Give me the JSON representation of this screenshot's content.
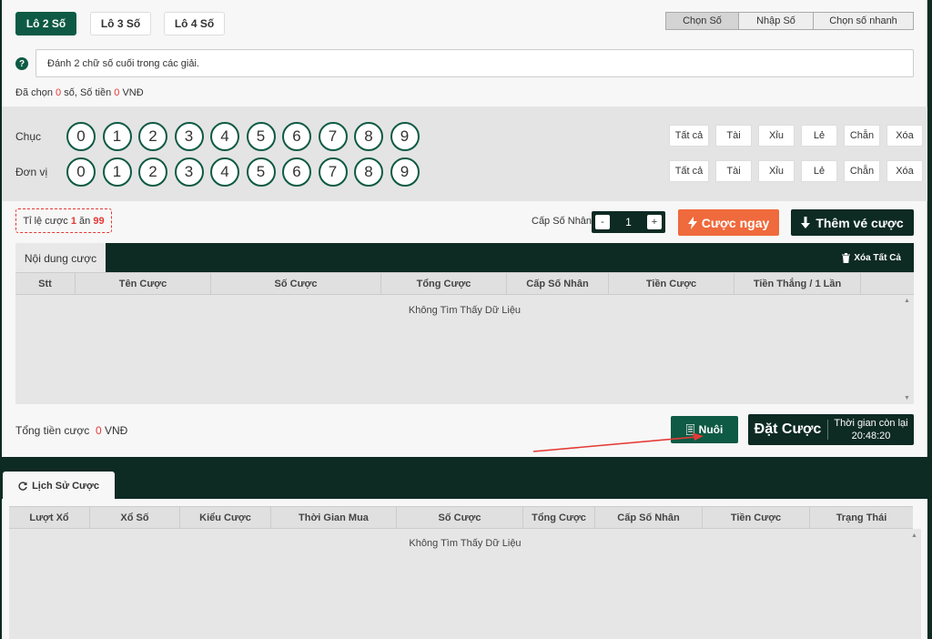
{
  "tabs": [
    {
      "label": "Lô 2 Số"
    },
    {
      "label": "Lô 3 Số"
    },
    {
      "label": "Lô 4 Số"
    }
  ],
  "modes": [
    {
      "label": "Chọn Số"
    },
    {
      "label": "Nhập Số"
    },
    {
      "label": "Chọn số nhanh"
    }
  ],
  "description": "Đánh 2 chữ số cuối trong các giải.",
  "summary": {
    "prefix": "Đã chọn",
    "count": "0",
    "mid": "số, Số tiền",
    "amount": "0",
    "currency": "VNĐ"
  },
  "picker": {
    "rows": [
      {
        "label": "Chục",
        "digits": [
          "0",
          "1",
          "2",
          "3",
          "4",
          "5",
          "6",
          "7",
          "8",
          "9"
        ]
      },
      {
        "label": "Đơn vị",
        "digits": [
          "0",
          "1",
          "2",
          "3",
          "4",
          "5",
          "6",
          "7",
          "8",
          "9"
        ]
      }
    ],
    "filters": [
      "Tất cả",
      "Tài",
      "Xỉu",
      "Lẻ",
      "Chẵn",
      "Xóa"
    ]
  },
  "odds": {
    "prefix": "Tỉ lệ cược",
    "left": "1",
    "mid": "ăn",
    "right": "99"
  },
  "multiplier": {
    "label": "Cấp Số Nhân",
    "minus": "-",
    "value": "1",
    "plus": "+"
  },
  "buttons": {
    "bet_now": "Cược ngay",
    "add_ticket": "Thêm vé cược",
    "nuoi": "Nuôi",
    "place_bet": "Đặt Cược"
  },
  "bet_table": {
    "tab": "Nội dung cược",
    "clear_all": "Xóa Tất Cả",
    "columns": [
      "Stt",
      "Tên Cược",
      "Số Cược",
      "Tổng Cược",
      "Cấp Số Nhân",
      "Tiền Cược",
      "Tiền Thắng / 1 Lần",
      ""
    ],
    "empty": "Không Tìm Thấy Dữ Liệu"
  },
  "total": {
    "label": "Tổng tiền cược",
    "value": "0",
    "currency": "VNĐ"
  },
  "timer": {
    "label": "Thời gian còn lại",
    "value": "20:48:20"
  },
  "history": {
    "tab": "Lịch Sử Cược",
    "columns": [
      "Lượt Xổ",
      "Xổ Số",
      "Kiểu Cược",
      "Thời Gian Mua",
      "Số Cược",
      "Tổng Cược",
      "Cấp Số Nhân",
      "Tiền Cược",
      "Trạng Thái"
    ],
    "empty": "Không Tìm Thấy Dữ Liệu"
  },
  "colors": {
    "primary": "#0e5a44",
    "dark": "#0d2a23",
    "accent": "#ef6a3c",
    "highlight": "#e53935"
  }
}
